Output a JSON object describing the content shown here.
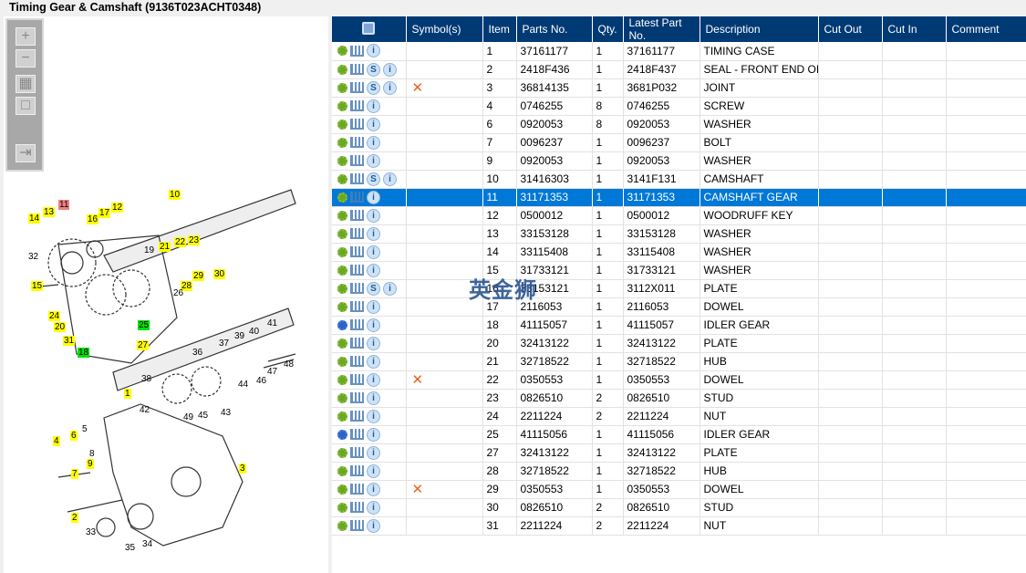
{
  "title": "Timing Gear & Camshaft (9136T023ACHT0348)",
  "toolbar": {
    "zoom_in": "+",
    "zoom_out": "−",
    "fit": "▦",
    "actual": "□",
    "export": "⇥"
  },
  "columns": [
    "",
    "Symbol(s)",
    "Item",
    "Parts No.",
    "Qty.",
    "Latest Part No.",
    "Description",
    "Cut Out",
    "Cut In",
    "Comment"
  ],
  "watermark": "英金狮",
  "colors": {
    "header": "#003a75",
    "selected": "#0078d7",
    "callout": "#ffff00",
    "callout_red": "#f08080",
    "callout_green": "#00e000"
  },
  "rows": [
    {
      "item": "1",
      "part": "37161177",
      "qty": "1",
      "latest": "37161177",
      "desc": "TIMING CASE",
      "s": false,
      "x": false,
      "gear": "green"
    },
    {
      "item": "2",
      "part": "2418F436",
      "qty": "1",
      "latest": "2418F437",
      "desc": "SEAL - FRONT END OIL",
      "s": true,
      "x": false,
      "gear": "green"
    },
    {
      "item": "3",
      "part": "36814135",
      "qty": "1",
      "latest": "3681P032",
      "desc": "JOINT",
      "s": true,
      "x": true,
      "gear": "green"
    },
    {
      "item": "4",
      "part": "0746255",
      "qty": "8",
      "latest": "0746255",
      "desc": "SCREW",
      "s": false,
      "x": false,
      "gear": "green"
    },
    {
      "item": "6",
      "part": "0920053",
      "qty": "8",
      "latest": "0920053",
      "desc": "WASHER",
      "s": false,
      "x": false,
      "gear": "green"
    },
    {
      "item": "7",
      "part": "0096237",
      "qty": "1",
      "latest": "0096237",
      "desc": "BOLT",
      "s": false,
      "x": false,
      "gear": "green"
    },
    {
      "item": "9",
      "part": "0920053",
      "qty": "1",
      "latest": "0920053",
      "desc": "WASHER",
      "s": false,
      "x": false,
      "gear": "green"
    },
    {
      "item": "10",
      "part": "31416303",
      "qty": "1",
      "latest": "3141F131",
      "desc": "CAMSHAFT",
      "s": true,
      "x": false,
      "gear": "green"
    },
    {
      "item": "11",
      "part": "31171353",
      "qty": "1",
      "latest": "31171353",
      "desc": "CAMSHAFT GEAR",
      "s": false,
      "x": false,
      "gear": "green",
      "selected": true
    },
    {
      "item": "12",
      "part": "0500012",
      "qty": "1",
      "latest": "0500012",
      "desc": "WOODRUFF KEY",
      "s": false,
      "x": false,
      "gear": "green"
    },
    {
      "item": "13",
      "part": "33153128",
      "qty": "1",
      "latest": "33153128",
      "desc": "WASHER",
      "s": false,
      "x": false,
      "gear": "green"
    },
    {
      "item": "14",
      "part": "33115408",
      "qty": "1",
      "latest": "33115408",
      "desc": "WASHER",
      "s": false,
      "x": false,
      "gear": "green"
    },
    {
      "item": "15",
      "part": "31733121",
      "qty": "1",
      "latest": "31733121",
      "desc": "WASHER",
      "s": false,
      "x": false,
      "gear": "green"
    },
    {
      "item": "16",
      "part": "33153121",
      "qty": "1",
      "latest": "3112X011",
      "desc": "PLATE",
      "s": true,
      "x": false,
      "gear": "green"
    },
    {
      "item": "17",
      "part": "2116053",
      "qty": "1",
      "latest": "2116053",
      "desc": "DOWEL",
      "s": false,
      "x": false,
      "gear": "green"
    },
    {
      "item": "18",
      "part": "41115057",
      "qty": "1",
      "latest": "41115057",
      "desc": "IDLER GEAR",
      "s": false,
      "x": false,
      "gear": "blue"
    },
    {
      "item": "20",
      "part": "32413122",
      "qty": "1",
      "latest": "32413122",
      "desc": "PLATE",
      "s": false,
      "x": false,
      "gear": "green"
    },
    {
      "item": "21",
      "part": "32718522",
      "qty": "1",
      "latest": "32718522",
      "desc": "HUB",
      "s": false,
      "x": false,
      "gear": "green"
    },
    {
      "item": "22",
      "part": "0350553",
      "qty": "1",
      "latest": "0350553",
      "desc": "DOWEL",
      "s": false,
      "x": true,
      "gear": "green"
    },
    {
      "item": "23",
      "part": "0826510",
      "qty": "2",
      "latest": "0826510",
      "desc": "STUD",
      "s": false,
      "x": false,
      "gear": "green"
    },
    {
      "item": "24",
      "part": "2211224",
      "qty": "2",
      "latest": "2211224",
      "desc": "NUT",
      "s": false,
      "x": false,
      "gear": "green"
    },
    {
      "item": "25",
      "part": "41115056",
      "qty": "1",
      "latest": "41115056",
      "desc": "IDLER GEAR",
      "s": false,
      "x": false,
      "gear": "blue"
    },
    {
      "item": "27",
      "part": "32413122",
      "qty": "1",
      "latest": "32413122",
      "desc": "PLATE",
      "s": false,
      "x": false,
      "gear": "green"
    },
    {
      "item": "28",
      "part": "32718522",
      "qty": "1",
      "latest": "32718522",
      "desc": "HUB",
      "s": false,
      "x": false,
      "gear": "green"
    },
    {
      "item": "29",
      "part": "0350553",
      "qty": "1",
      "latest": "0350553",
      "desc": "DOWEL",
      "s": false,
      "x": true,
      "gear": "green"
    },
    {
      "item": "30",
      "part": "0826510",
      "qty": "2",
      "latest": "0826510",
      "desc": "STUD",
      "s": false,
      "x": false,
      "gear": "green"
    },
    {
      "item": "31",
      "part": "2211224",
      "qty": "2",
      "latest": "2211224",
      "desc": "NUT",
      "s": false,
      "x": false,
      "gear": "green"
    }
  ],
  "callouts": [
    {
      "n": "10",
      "c": "y"
    },
    {
      "n": "11",
      "c": "r"
    },
    {
      "n": "12",
      "c": "y"
    },
    {
      "n": "13",
      "c": "y"
    },
    {
      "n": "14",
      "c": "y"
    },
    {
      "n": "16",
      "c": "y"
    },
    {
      "n": "17",
      "c": "y"
    },
    {
      "n": "32",
      "c": ""
    },
    {
      "n": "15",
      "c": "y"
    },
    {
      "n": "19",
      "c": ""
    },
    {
      "n": "21",
      "c": "y"
    },
    {
      "n": "22",
      "c": "y"
    },
    {
      "n": "23",
      "c": "y"
    },
    {
      "n": "29",
      "c": "y"
    },
    {
      "n": "30",
      "c": "y"
    },
    {
      "n": "28",
      "c": "y"
    },
    {
      "n": "26",
      "c": ""
    },
    {
      "n": "24",
      "c": "y"
    },
    {
      "n": "20",
      "c": "y"
    },
    {
      "n": "31",
      "c": "y"
    },
    {
      "n": "25",
      "c": "g"
    },
    {
      "n": "18",
      "c": "g"
    },
    {
      "n": "27",
      "c": "y"
    },
    {
      "n": "36",
      "c": ""
    },
    {
      "n": "37",
      "c": ""
    },
    {
      "n": "39",
      "c": ""
    },
    {
      "n": "40",
      "c": ""
    },
    {
      "n": "41",
      "c": ""
    },
    {
      "n": "48",
      "c": ""
    },
    {
      "n": "47",
      "c": ""
    },
    {
      "n": "46",
      "c": ""
    },
    {
      "n": "44",
      "c": ""
    },
    {
      "n": "38",
      "c": ""
    },
    {
      "n": "42",
      "c": ""
    },
    {
      "n": "49",
      "c": ""
    },
    {
      "n": "45",
      "c": ""
    },
    {
      "n": "43",
      "c": ""
    },
    {
      "n": "1",
      "c": "y"
    },
    {
      "n": "5",
      "c": ""
    },
    {
      "n": "6",
      "c": "y"
    },
    {
      "n": "4",
      "c": "y"
    },
    {
      "n": "8",
      "c": ""
    },
    {
      "n": "9",
      "c": "y"
    },
    {
      "n": "7",
      "c": "y"
    },
    {
      "n": "3",
      "c": "y"
    },
    {
      "n": "2",
      "c": "y"
    },
    {
      "n": "33",
      "c": ""
    },
    {
      "n": "35",
      "c": ""
    },
    {
      "n": "34",
      "c": ""
    }
  ]
}
